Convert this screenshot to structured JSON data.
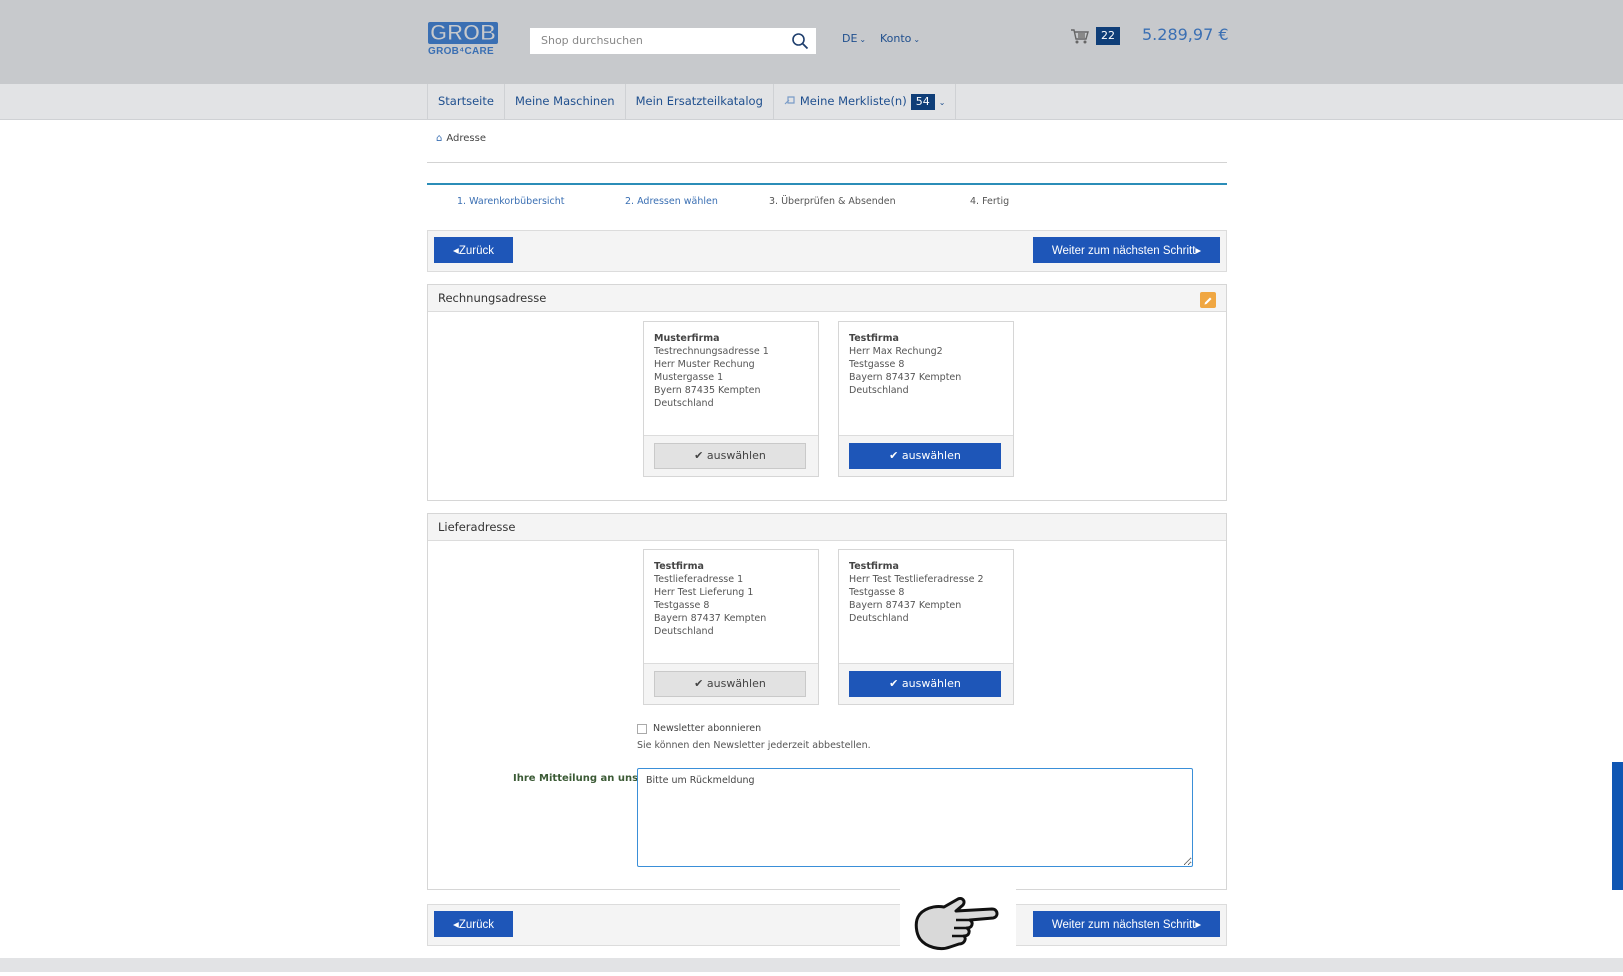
{
  "header": {
    "logo_line1": "GROB",
    "logo_line2": "GROB⁴CARE",
    "search_placeholder": "Shop durchsuchen",
    "lang": "DE",
    "account": "Konto",
    "cart_count": "22",
    "cart_total": "5.289,97 €"
  },
  "nav": {
    "items": [
      "Startseite",
      "Meine Maschinen",
      "Mein Ersatzteilkatalog",
      "Meine Merkliste(n)"
    ],
    "wishlist_count": "54"
  },
  "breadcrumb": "Adresse",
  "steps": [
    "1. Warenkorbübersicht",
    "2. Adressen wählen",
    "3. Überprüfen & Absenden",
    "4. Fertig"
  ],
  "actions": {
    "back": "Zurück",
    "next": "Weiter zum nächsten Schritt"
  },
  "billing": {
    "title": "Rechnungsadresse",
    "addresses": [
      {
        "firm": "Musterfirma",
        "lines": [
          "Testrechnungsadresse 1",
          "Herr Muster Rechung",
          "Mustergasse 1",
          "Byern 87435 Kempten",
          "Deutschland"
        ],
        "button": "auswählen",
        "selected": true
      },
      {
        "firm": "Testfirma",
        "lines": [
          "Herr Max Rechung2",
          "Testgasse 8",
          "Bayern 87437 Kempten",
          "Deutschland"
        ],
        "button": "auswählen",
        "selected": false
      }
    ]
  },
  "shipping": {
    "title": "Lieferadresse",
    "addresses": [
      {
        "firm": "Testfirma",
        "lines": [
          "Testlieferadresse 1",
          "Herr Test Lieferung 1",
          "Testgasse 8",
          "Bayern 87437 Kempten",
          "Deutschland"
        ],
        "button": "auswählen",
        "selected": true
      },
      {
        "firm": "Testfirma",
        "lines": [
          "Herr Test Testlieferadresse 2",
          "Testgasse 8",
          "Bayern 87437 Kempten",
          "Deutschland"
        ],
        "button": "auswählen",
        "selected": false
      }
    ],
    "newsletter_label": "Newsletter abonnieren",
    "newsletter_note": "Sie können den Newsletter jederzeit abbestellen.",
    "message_label": "Ihre Mitteilung an uns",
    "message_value": "Bitte um Rückmeldung"
  },
  "colors": {
    "primary": "#1e56b8",
    "accent": "#2b8db8",
    "badge": "#0f3e78",
    "edit": "#f0a742"
  }
}
